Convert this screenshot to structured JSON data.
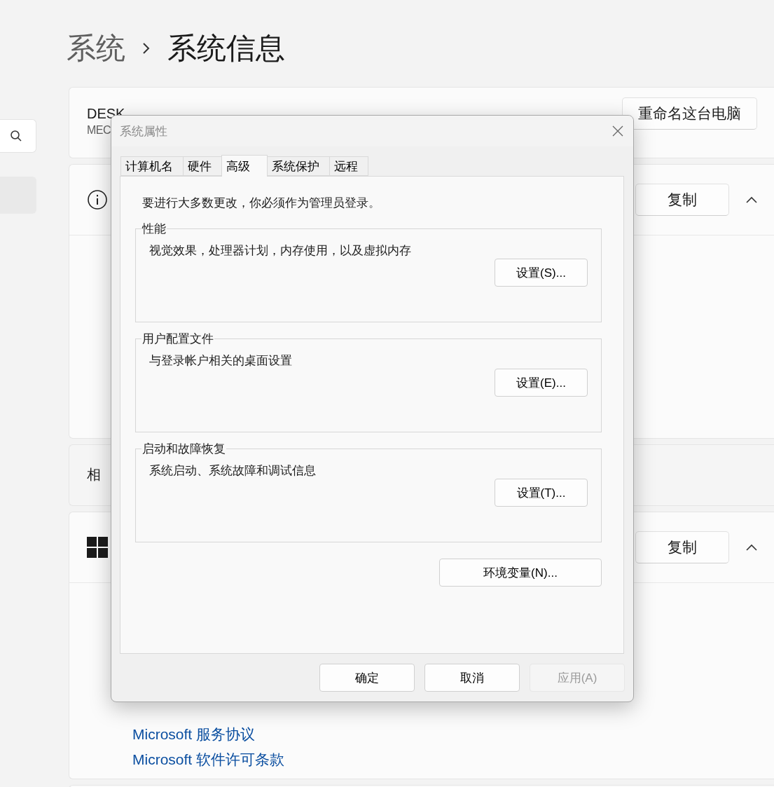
{
  "breadcrumb": [
    {
      "label": "系统"
    },
    {
      "label": "系统信息"
    }
  ],
  "device_card": {
    "name": "DESK",
    "model": "MEC",
    "button": "重命名这台电脑"
  },
  "sections": [
    {
      "kind": "info",
      "button": "复制",
      "expanded": true
    },
    {
      "kind": "related",
      "label": "相"
    },
    {
      "kind": "windows",
      "button": "复制",
      "expanded": true,
      "links": [
        "Microsoft 服务协议",
        "Microsoft 软件许可条款"
      ]
    }
  ],
  "dialog": {
    "title": "系统属性",
    "tabs": [
      {
        "label": "计算机名",
        "selected": false
      },
      {
        "label": "硬件",
        "selected": false
      },
      {
        "label": "高级",
        "selected": true
      },
      {
        "label": "系统保护",
        "selected": false
      },
      {
        "label": "远程",
        "selected": false
      }
    ],
    "notice": "要进行大多数更改，你必须作为管理员登录。",
    "groups": [
      {
        "title": "性能",
        "description": "视觉效果，处理器计划，内存使用，以及虚拟内存",
        "button": "设置(S)..."
      },
      {
        "title": "用户配置文件",
        "description": "与登录帐户相关的桌面设置",
        "button": "设置(E)..."
      },
      {
        "title": "启动和故障恢复",
        "description": "系统启动、系统故障和调试信息",
        "button": "设置(T)..."
      }
    ],
    "env_button": "环境变量(N)...",
    "buttons": [
      {
        "label": "确定",
        "disabled": false
      },
      {
        "label": "取消",
        "disabled": false
      },
      {
        "label": "应用(A)",
        "disabled": true
      }
    ]
  }
}
